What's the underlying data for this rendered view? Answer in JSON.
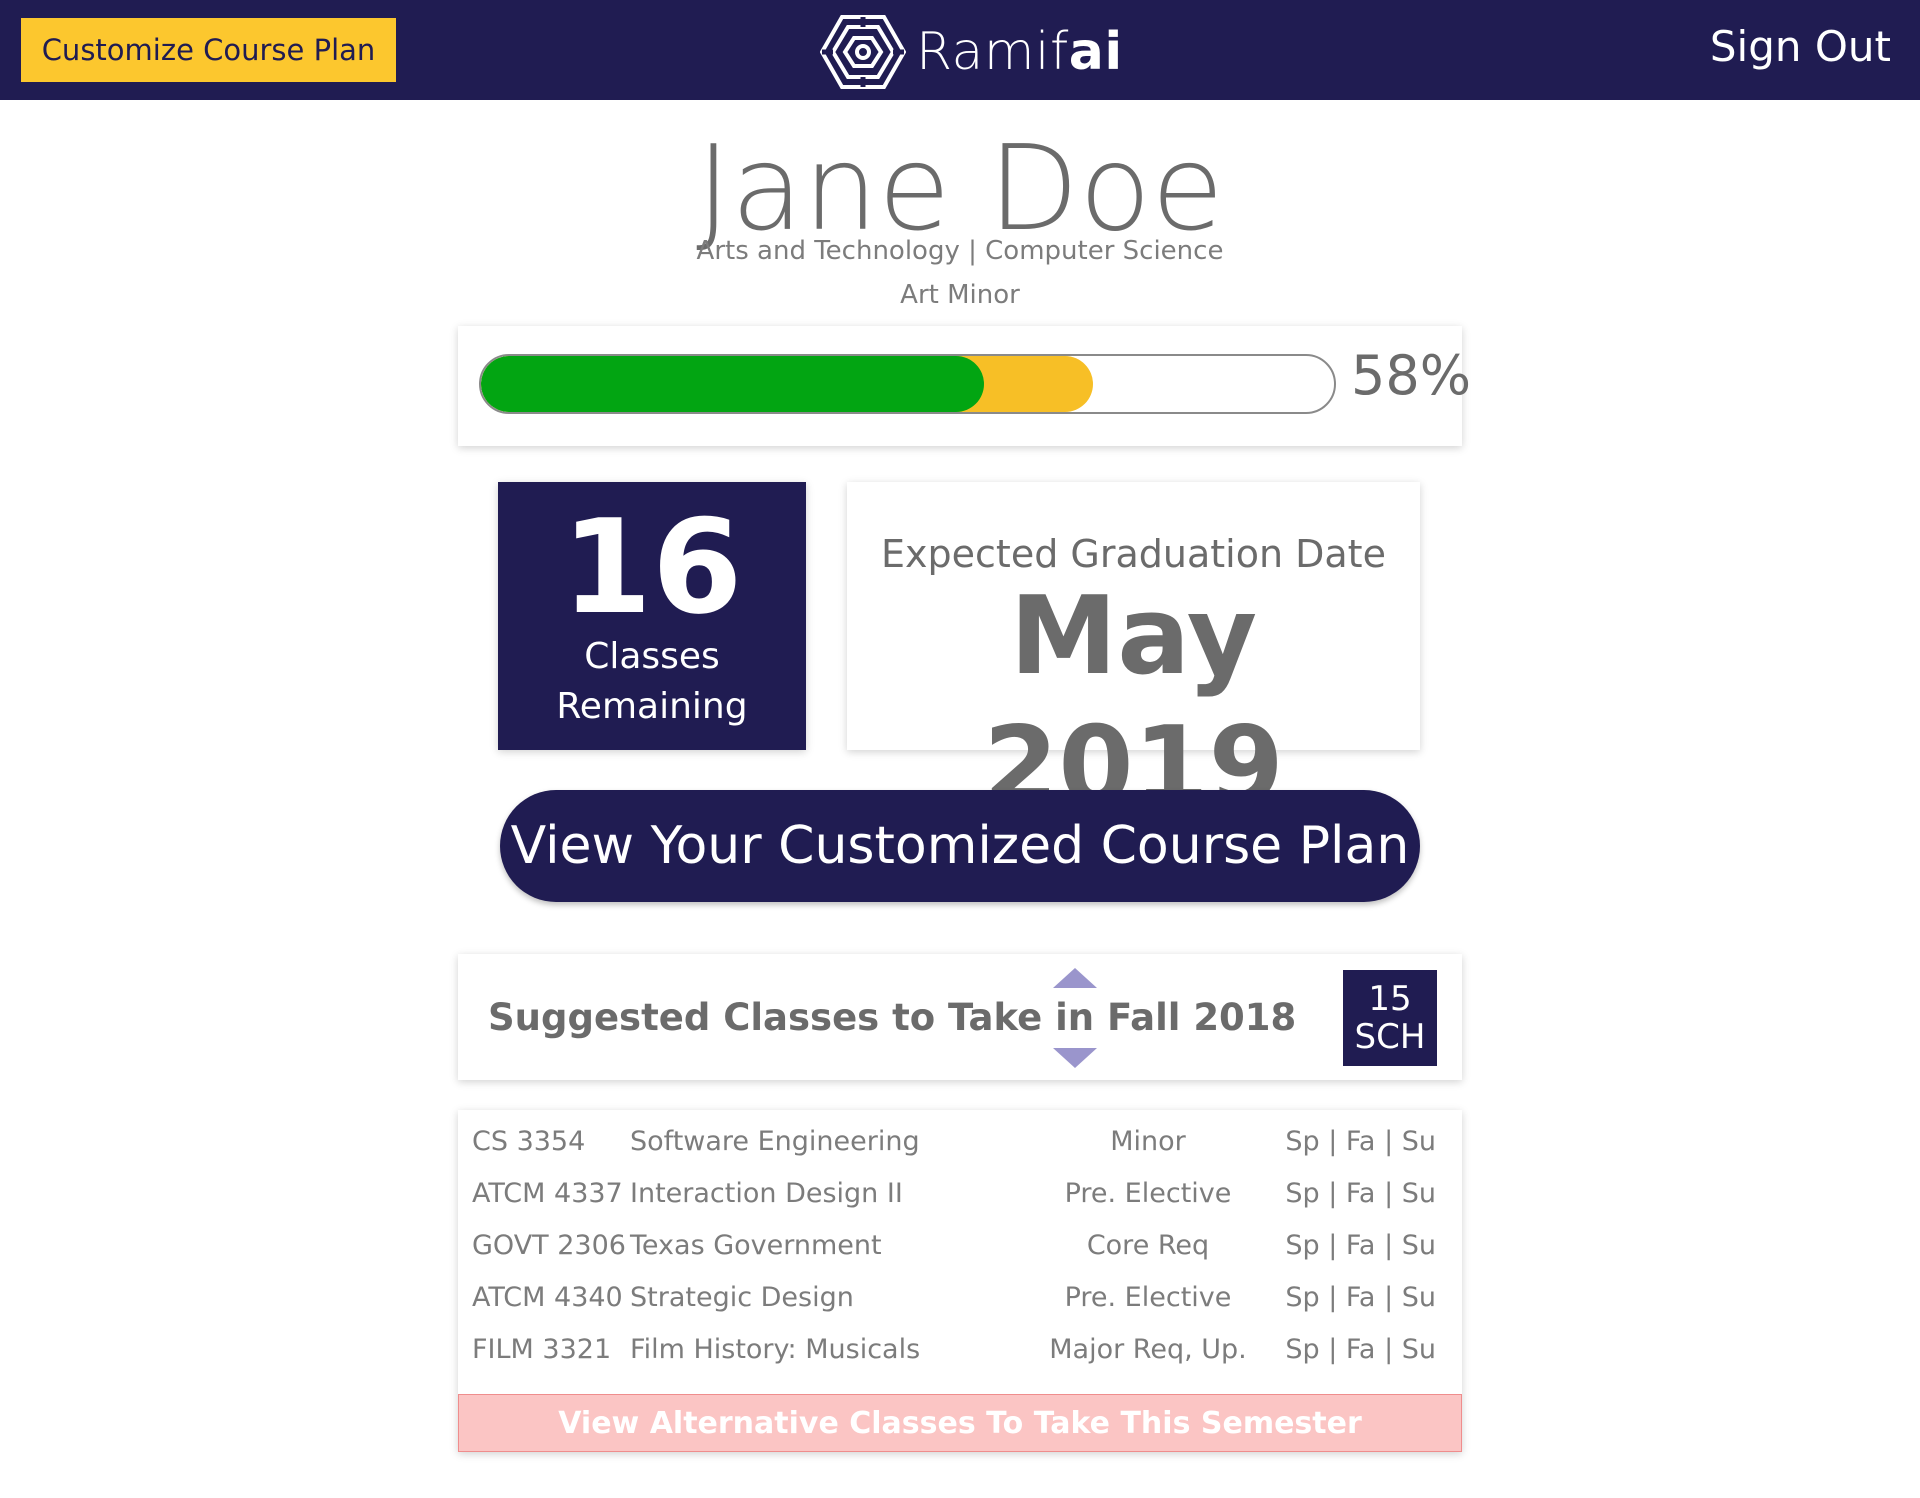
{
  "header": {
    "customize_label": "Customize Course Plan",
    "brand_name": "Ramif",
    "brand_ai": "ai",
    "sign_out_label": "Sign Out"
  },
  "student": {
    "name": "Jane Doe",
    "program": "Arts and Technology | Computer Science",
    "minor": "Art Minor"
  },
  "progress": {
    "percent_label": "58%",
    "completed_fraction": 0.59,
    "planned_fraction": 0.717
  },
  "stats": {
    "classes_remaining": "16",
    "classes_label_1": "Classes",
    "classes_label_2": "Remaining",
    "graduation_label": "Expected Graduation Date",
    "graduation_date": "May 2019"
  },
  "view_plan_label": "View Your Customized Course Plan",
  "suggested": {
    "title": "Suggested Classes to Take in Fall 2018",
    "sch_value": "15",
    "sch_unit": "SCH",
    "classes": [
      {
        "code": "CS 3354",
        "title": "Software Engineering",
        "type": "Minor",
        "terms": "Sp | Fa | Su"
      },
      {
        "code": "ATCM 4337",
        "title": "Interaction Design II",
        "type": "Pre. Elective",
        "terms": "Sp | Fa | Su"
      },
      {
        "code": "GOVT 2306",
        "title": "Texas Government",
        "type": "Core Req",
        "terms": "Sp | Fa | Su"
      },
      {
        "code": "ATCM 4340",
        "title": "Strategic Design",
        "type": "Pre. Elective",
        "terms": "Sp | Fa | Su"
      },
      {
        "code": "FILM 3321",
        "title": "Film History: Musicals",
        "type": "Major Req, Up.",
        "terms": "Sp | Fa | Su"
      }
    ],
    "alternative_label": "View Alternative Classes To Take This Semester"
  },
  "colors": {
    "navy": "#201c52",
    "yellow": "#fcc72e",
    "green": "#02a512",
    "amber": "#f7bf26",
    "pink": "#fbc5c4"
  }
}
